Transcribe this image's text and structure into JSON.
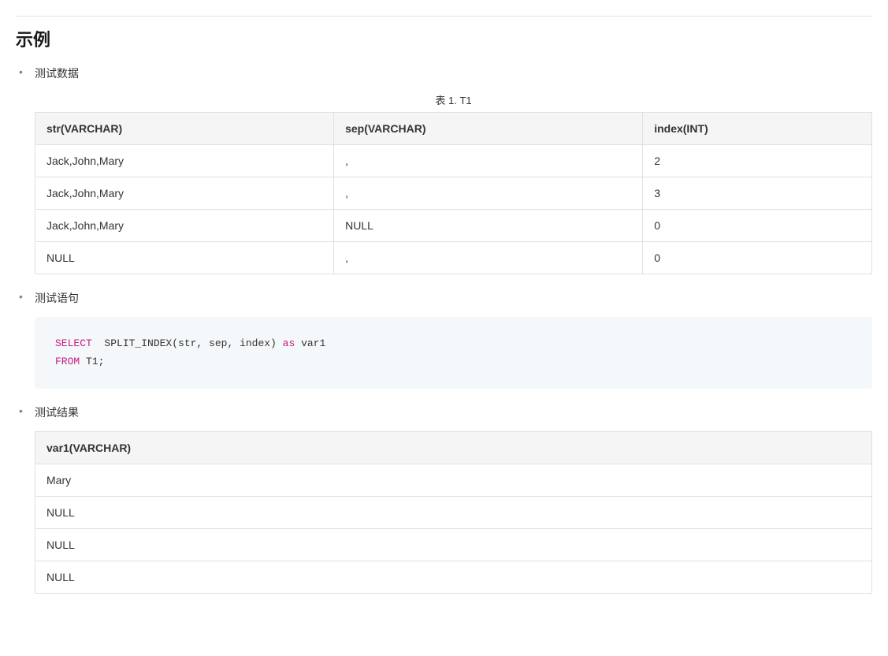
{
  "section_title": "示例",
  "bullets": {
    "test_data": "测试数据",
    "test_stmt": "测试语句",
    "test_result": "测试结果"
  },
  "table1": {
    "caption": "表 1. T1",
    "headers": [
      "str(VARCHAR)",
      "sep(VARCHAR)",
      "index(INT)"
    ],
    "rows": [
      [
        "Jack,John,Mary",
        ",",
        "2"
      ],
      [
        "Jack,John,Mary",
        ",",
        "3"
      ],
      [
        "Jack,John,Mary",
        "NULL",
        "0"
      ],
      [
        "NULL",
        ",",
        "0"
      ]
    ]
  },
  "code": {
    "select_kw": "SELECT",
    "body": "  SPLIT_INDEX(str, sep, index) ",
    "as_kw": "as",
    "alias": " var1",
    "from_kw": "FROM",
    "from_rest": " T1;"
  },
  "table2": {
    "headers": [
      "var1(VARCHAR)"
    ],
    "rows": [
      [
        "Mary"
      ],
      [
        "NULL"
      ],
      [
        "NULL"
      ],
      [
        "NULL"
      ]
    ]
  }
}
